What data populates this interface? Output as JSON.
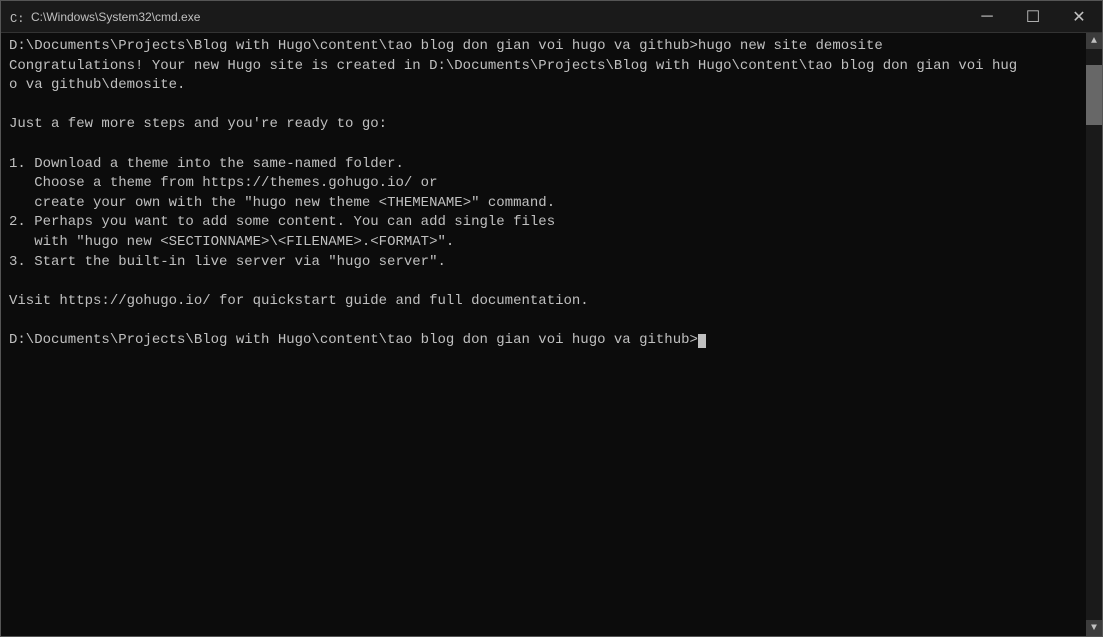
{
  "titlebar": {
    "title": "C:\\Windows\\System32\\cmd.exe",
    "minimize_label": "─",
    "restore_label": "☐",
    "close_label": "✕"
  },
  "terminal": {
    "lines": [
      "D:\\Documents\\Projects\\Blog with Hugo\\content\\tao blog don gian voi hugo va github>hugo new site demosite",
      "Congratulations! Your new Hugo site is created in D:\\Documents\\Projects\\Blog with Hugo\\content\\tao blog don gian voi hug\no va github\\demosite.\n",
      "Just a few more steps and you're ready to go:\n",
      "1. Download a theme into the same-named folder.\n   Choose a theme from https://themes.gohugo.io/ or\n   create your own with the \"hugo new theme <THEMENAME>\" command.\n2. Perhaps you want to add some content. You can add single files\n   with \"hugo new <SECTIONNAME>\\<FILENAME>.<FORMAT>\".\n3. Start the built-in live server via \"hugo server\".\n",
      "Visit https://gohugo.io/ for quickstart guide and full documentation.\n",
      "D:\\Documents\\Projects\\Blog with Hugo\\content\\tao blog don gian voi hugo va github>"
    ]
  }
}
